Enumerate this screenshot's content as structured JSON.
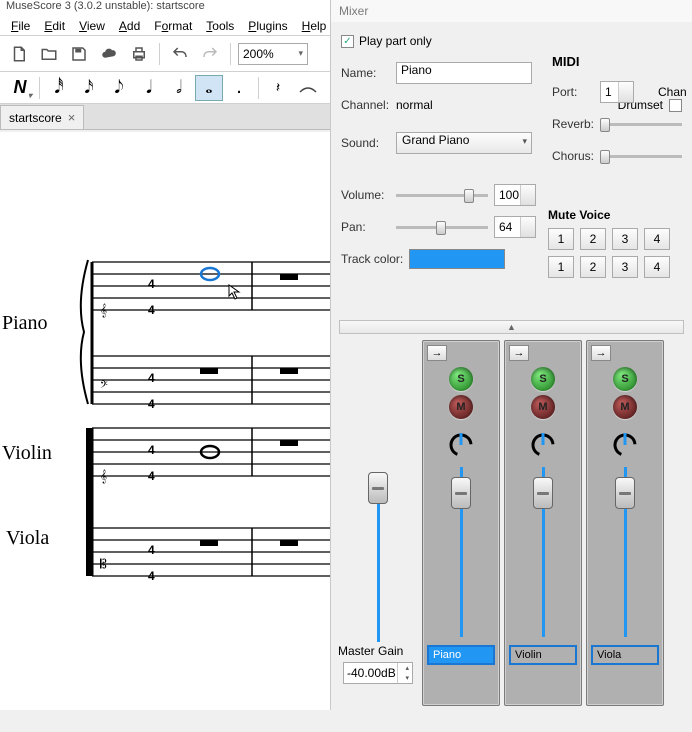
{
  "title": "MuseScore 3 (3.0.2 unstable): startscore",
  "menu": [
    "File",
    "Edit",
    "View",
    "Add",
    "Format",
    "Tools",
    "Plugins",
    "Help"
  ],
  "zoom": "200%",
  "tab": {
    "name": "startscore"
  },
  "instruments": [
    "Piano",
    "Violin",
    "Viola"
  ],
  "mixer": {
    "title": "Mixer",
    "play_part_only": {
      "label": "Play part only",
      "checked": true
    },
    "name_label": "Name:",
    "name_value": "Piano",
    "channel_label": "Channel:",
    "channel_value": "normal",
    "drumset_label": "Drumset",
    "sound_label": "Sound:",
    "sound_value": "Grand Piano",
    "volume_label": "Volume:",
    "volume_value": "100",
    "pan_label": "Pan:",
    "pan_value": "64",
    "track_color_label": "Track color:",
    "track_color": "#2196f3",
    "midi_label": "MIDI",
    "port_label": "Port:",
    "port_value": "1",
    "chan_label": "Chan",
    "reverb_label": "Reverb:",
    "chorus_label": "Chorus:",
    "mute_voice_label": "Mute Voice",
    "mv_buttons": [
      "1",
      "2",
      "3",
      "4"
    ],
    "master_gain_label": "Master Gain",
    "master_gain_value": "-40.00dB",
    "channels": [
      {
        "name": "Piano",
        "selected": true
      },
      {
        "name": "Violin",
        "selected": false
      },
      {
        "name": "Viola",
        "selected": false
      }
    ]
  }
}
